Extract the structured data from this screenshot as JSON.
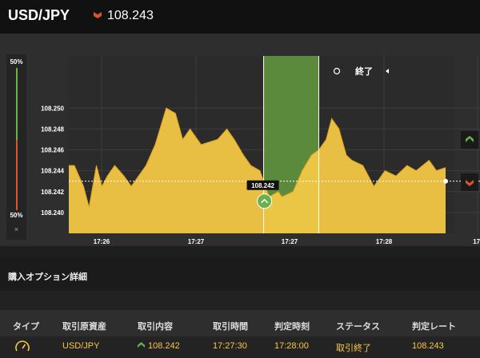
{
  "header": {
    "pair": "USD/JPY",
    "rate_direction_icon": "down-arrow-icon",
    "rate": "108.243"
  },
  "side_panel": {
    "top_pct": "50%",
    "bottom_pct": "50%",
    "close": "×"
  },
  "chart_data": {
    "type": "area",
    "series": [
      {
        "values": [
          [
            "17:25:44",
            108.2445
          ],
          [
            "17:25:47",
            108.2445
          ],
          [
            "17:25:52",
            108.2425
          ],
          [
            "17:25:55",
            108.2405
          ],
          [
            "17:25:59",
            108.2445
          ],
          [
            "17:26:02",
            108.2425
          ],
          [
            "17:26:05",
            108.2435
          ],
          [
            "17:26:09",
            108.2445
          ],
          [
            "17:26:14",
            108.2435
          ],
          [
            "17:26:18",
            108.2425
          ],
          [
            "17:26:22",
            108.2435
          ],
          [
            "17:26:26",
            108.2445
          ],
          [
            "17:26:31",
            108.2465
          ],
          [
            "17:26:37",
            108.25
          ],
          [
            "17:26:42",
            108.2495
          ],
          [
            "17:26:46",
            108.247
          ],
          [
            "17:26:50",
            108.248
          ],
          [
            "17:26:56",
            108.2465
          ],
          [
            "17:27:05",
            108.247
          ],
          [
            "17:27:10",
            108.248
          ],
          [
            "17:27:14",
            108.247
          ],
          [
            "17:27:19",
            108.2455
          ],
          [
            "17:27:23",
            108.2445
          ],
          [
            "17:27:28",
            108.244
          ],
          [
            "17:27:33",
            108.2415
          ],
          [
            "17:27:38",
            108.242
          ],
          [
            "17:27:40",
            108.2415
          ],
          [
            "17:27:46",
            108.242
          ],
          [
            "17:27:51",
            108.244
          ],
          [
            "17:27:56",
            108.2455
          ],
          [
            "17:28:00",
            108.246
          ],
          [
            "17:28:04",
            108.247
          ],
          [
            "17:28:07",
            108.249
          ],
          [
            "17:28:11",
            108.248
          ],
          [
            "17:28:15",
            108.2455
          ],
          [
            "17:28:18",
            108.245
          ],
          [
            "17:28:24",
            108.2445
          ],
          [
            "17:28:30",
            108.2425
          ],
          [
            "17:28:36",
            108.244
          ],
          [
            "17:28:42",
            108.2435
          ],
          [
            "17:28:48",
            108.2445
          ],
          [
            "17:28:53",
            108.244
          ],
          [
            "17:29:00",
            108.245
          ],
          [
            "17:29:04",
            108.244
          ],
          [
            "17:29:09",
            108.2443
          ]
        ]
      }
    ],
    "x_ticks": [
      "17:26",
      "17:27",
      "17:27",
      "17:28",
      "17:"
    ],
    "y_ticks": [
      "108.250",
      "108.248",
      "108.246",
      "108.244",
      "108.242",
      "108.240"
    ],
    "ylim": [
      108.238,
      108.255
    ],
    "grid": true,
    "current_rate": 108.243,
    "entry_label": "108.242",
    "entry_time": "17:27:30",
    "end_time": "17:28:00",
    "highlight_label": "終了",
    "area_color": "#f6c945",
    "highlight_color": "#5e8f3d"
  },
  "right_controls": {
    "up_icon": "up-arrow-icon",
    "down_icon": "down-arrow-icon"
  },
  "section": {
    "title": "購入オプション詳細"
  },
  "table": {
    "headers": [
      "タイプ",
      "取引原資産",
      "取引内容",
      "取引時間",
      "判定時刻",
      "ステータス",
      "判定レート"
    ],
    "row": {
      "type_icon": "gauge-icon",
      "asset": "USD/JPY",
      "direction_icon": "up-arrow-icon",
      "content": "108.242",
      "trade_time": "17:27:30",
      "judge_time": "17:28:00",
      "status": "取引終了",
      "judge_rate": "108.243"
    }
  },
  "colors": {
    "up": "#6ab04c",
    "down": "#d9532c",
    "accent": "#f6c945"
  }
}
